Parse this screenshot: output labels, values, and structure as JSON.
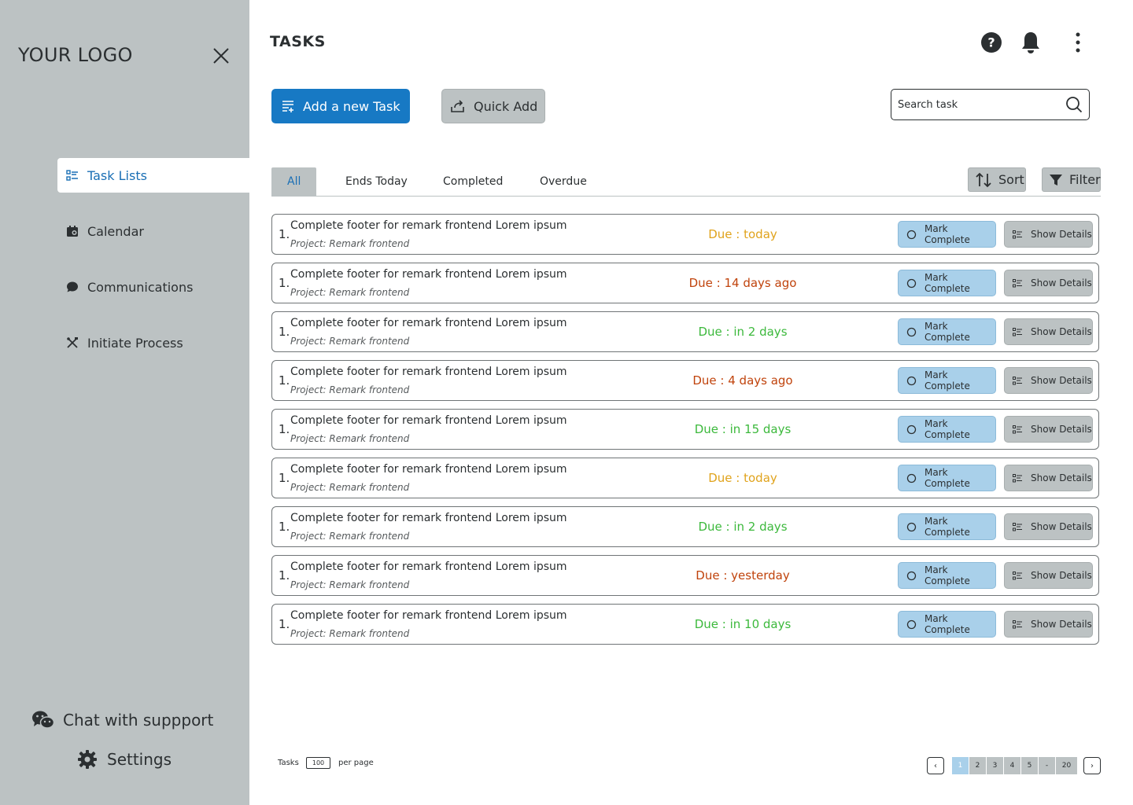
{
  "sidebar": {
    "logo": "YOUR LOGO",
    "items": [
      {
        "label": "Task Lists",
        "icon": "task-list-icon",
        "active": true
      },
      {
        "label": "Calendar",
        "icon": "calendar-icon",
        "active": false
      },
      {
        "label": "Communications",
        "icon": "chat-bubble-icon",
        "active": false
      },
      {
        "label": "Initiate Process",
        "icon": "tools-icon",
        "active": false
      }
    ],
    "support_label": "Chat with suppport",
    "settings_label": "Settings"
  },
  "header": {
    "title": "TASKS",
    "icons": [
      "help-icon",
      "bell-icon",
      "more-vertical-icon"
    ]
  },
  "actions": {
    "add_label": "Add a new Task",
    "quick_add_label": "Quick Add",
    "search_placeholder": "Search task"
  },
  "tabs": [
    {
      "label": "All",
      "active": true
    },
    {
      "label": "Ends Today",
      "active": false
    },
    {
      "label": "Completed",
      "active": false
    },
    {
      "label": "Overdue",
      "active": false
    }
  ],
  "toolbar": {
    "sort_label": "Sort",
    "filter_label": "Filter"
  },
  "tasks": [
    {
      "num": "1.",
      "title": "Complete footer for remark frontend Lorem ipsum",
      "project": "Project: Remark frontend",
      "due": "Due : today",
      "status": "today"
    },
    {
      "num": "1.",
      "title": "Complete footer for remark frontend Lorem ipsum",
      "project": "Project: Remark frontend",
      "due": "Due : 14 days ago",
      "status": "overdue"
    },
    {
      "num": "1.",
      "title": "Complete footer for remark frontend Lorem ipsum",
      "project": "Project: Remark frontend",
      "due": "Due :  in 2 days",
      "status": "upcoming"
    },
    {
      "num": "1.",
      "title": "Complete footer for remark frontend Lorem ipsum",
      "project": "Project: Remark frontend",
      "due": "Due : 4 days ago",
      "status": "overdue"
    },
    {
      "num": "1.",
      "title": "Complete footer for remark frontend Lorem ipsum",
      "project": "Project: Remark frontend",
      "due": "Due :  in 15 days",
      "status": "upcoming"
    },
    {
      "num": "1.",
      "title": "Complete footer for remark frontend Lorem ipsum",
      "project": "Project: Remark frontend",
      "due": "Due : today",
      "status": "today"
    },
    {
      "num": "1.",
      "title": "Complete footer for remark frontend Lorem ipsum",
      "project": "Project: Remark frontend",
      "due": "Due :  in 2 days",
      "status": "upcoming"
    },
    {
      "num": "1.",
      "title": "Complete footer for remark frontend Lorem ipsum",
      "project": "Project: Remark frontend",
      "due": "Due : yesterday",
      "status": "overdue"
    },
    {
      "num": "1.",
      "title": "Complete footer for remark frontend Lorem ipsum",
      "project": "Project: Remark frontend",
      "due": "Due :  in 10 days",
      "status": "upcoming"
    }
  ],
  "row_buttons": {
    "mark_complete": "Mark Complete",
    "show_details": "Show Details"
  },
  "status_colors": {
    "today": "#e0a31c",
    "overdue": "#c0430c",
    "upcoming": "#3cb93c"
  },
  "colors": {
    "primary": "#1779c4",
    "sidebar_bg": "#bcc2c3",
    "mark_btn_bg": "#a9d0ea"
  },
  "footer": {
    "tasks_label": "Tasks",
    "per_page_value": "100",
    "per_page_label": "per page",
    "prev": "‹",
    "next": "›",
    "pages": [
      {
        "label": "1",
        "active": true
      },
      {
        "label": "2",
        "active": false
      },
      {
        "label": "3",
        "active": false
      },
      {
        "label": "4",
        "active": false
      },
      {
        "label": "5",
        "active": false
      },
      {
        "label": "-",
        "active": false
      },
      {
        "label": "20",
        "active": false
      }
    ]
  }
}
